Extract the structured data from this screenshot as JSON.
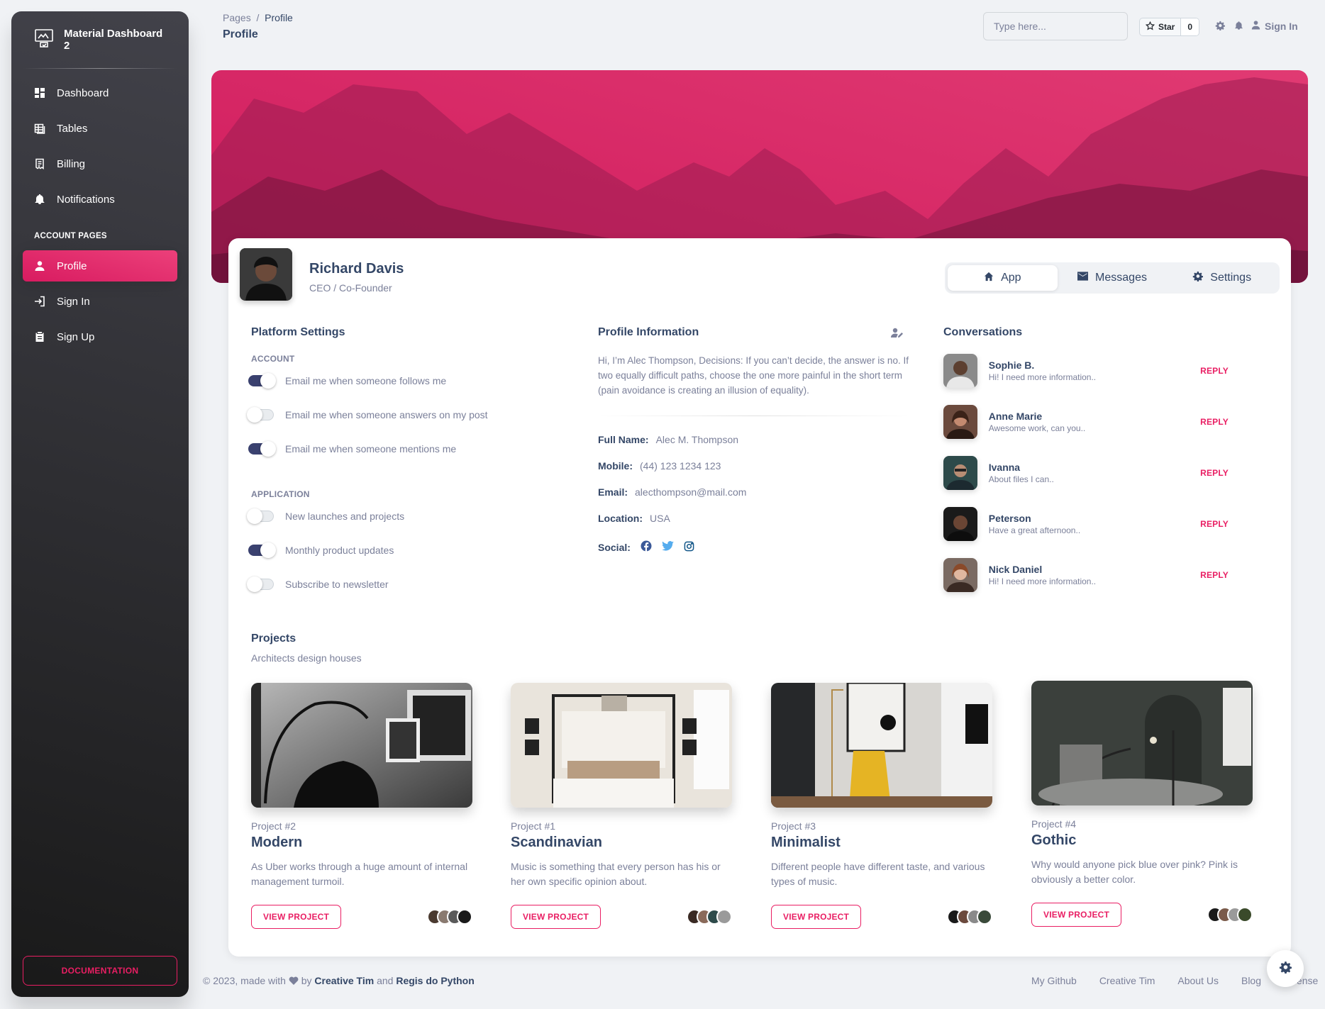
{
  "brand": {
    "name": "Material Dashboard 2"
  },
  "sidebar": {
    "items": [
      {
        "label": "Dashboard",
        "icon": "dashboard-icon"
      },
      {
        "label": "Tables",
        "icon": "table-icon"
      },
      {
        "label": "Billing",
        "icon": "receipt-icon"
      },
      {
        "label": "Notifications",
        "icon": "bell-icon"
      }
    ],
    "section_heading": "ACCOUNT PAGES",
    "account_items": [
      {
        "label": "Profile",
        "icon": "person-icon",
        "active": true
      },
      {
        "label": "Sign In",
        "icon": "login-icon"
      },
      {
        "label": "Sign Up",
        "icon": "clipboard-icon"
      }
    ],
    "documentation_label": "DOCUMENTATION"
  },
  "topbar": {
    "breadcrumb_root": "Pages",
    "breadcrumb_sep": "/",
    "breadcrumb_current": "Profile",
    "title": "Profile",
    "search_placeholder": "Type here...",
    "star_label": "Star",
    "star_count": "0",
    "signin_label": "Sign In"
  },
  "profile": {
    "name": "Richard Davis",
    "role": "CEO / Co-Founder",
    "tabs": [
      {
        "label": "App",
        "icon": "home-icon",
        "active": true
      },
      {
        "label": "Messages",
        "icon": "email-icon"
      },
      {
        "label": "Settings",
        "icon": "gear-icon"
      }
    ]
  },
  "platform_settings": {
    "title": "Platform Settings",
    "account_heading": "ACCOUNT",
    "account_toggles": [
      {
        "label": "Email me when someone follows me",
        "on": true
      },
      {
        "label": "Email me when someone answers on my post",
        "on": false
      },
      {
        "label": "Email me when someone mentions me",
        "on": true
      }
    ],
    "application_heading": "APPLICATION",
    "application_toggles": [
      {
        "label": "New launches and projects",
        "on": false
      },
      {
        "label": "Monthly product updates",
        "on": true
      },
      {
        "label": "Subscribe to newsletter",
        "on": false
      }
    ]
  },
  "profile_info": {
    "title": "Profile Information",
    "bio": "Hi, I’m Alec Thompson, Decisions: If you can’t decide, the answer is no. If two equally difficult paths, choose the one more painful in the short term (pain avoidance is creating an illusion of equality).",
    "fields": [
      {
        "label": "Full Name:",
        "value": "Alec M. Thompson"
      },
      {
        "label": "Mobile:",
        "value": "(44) 123 1234 123"
      },
      {
        "label": "Email:",
        "value": "alecthompson@mail.com"
      },
      {
        "label": "Location:",
        "value": "USA"
      }
    ],
    "social_label": "Social:",
    "social_colors": {
      "facebook": "#3b5998",
      "twitter": "#55acee",
      "instagram": "#125688"
    }
  },
  "conversations": {
    "title": "Conversations",
    "reply_label": "REPLY",
    "items": [
      {
        "name": "Sophie B.",
        "message": "Hi! I need more information.."
      },
      {
        "name": "Anne Marie",
        "message": "Awesome work, can you.."
      },
      {
        "name": "Ivanna",
        "message": "About files I can.."
      },
      {
        "name": "Peterson",
        "message": "Have a great afternoon.."
      },
      {
        "name": "Nick Daniel",
        "message": "Hi! I need more information.."
      }
    ]
  },
  "projects": {
    "title": "Projects",
    "subtitle": "Architects design houses",
    "button_label": "VIEW PROJECT",
    "items": [
      {
        "label": "Project #2",
        "name": "Modern",
        "description": "As Uber works through a huge amount of internal management turmoil."
      },
      {
        "label": "Project #1",
        "name": "Scandinavian",
        "description": "Music is something that every person has his or her own specific opinion about."
      },
      {
        "label": "Project #3",
        "name": "Minimalist",
        "description": "Different people have different taste, and various types of music."
      },
      {
        "label": "Project #4",
        "name": "Gothic",
        "description": "Why would anyone pick blue over pink? Pink is obviously a better color."
      }
    ]
  },
  "footer": {
    "prefix": "© 2023, made with",
    "by": "by",
    "author1": "Creative Tim",
    "and": "and",
    "author2": "Regis do Python",
    "links": [
      "My Github",
      "Creative Tim",
      "About Us",
      "Blog",
      "License"
    ]
  },
  "colors": {
    "accent": "#e91e63",
    "text_dark": "#344767",
    "text_muted": "#7b809a"
  }
}
